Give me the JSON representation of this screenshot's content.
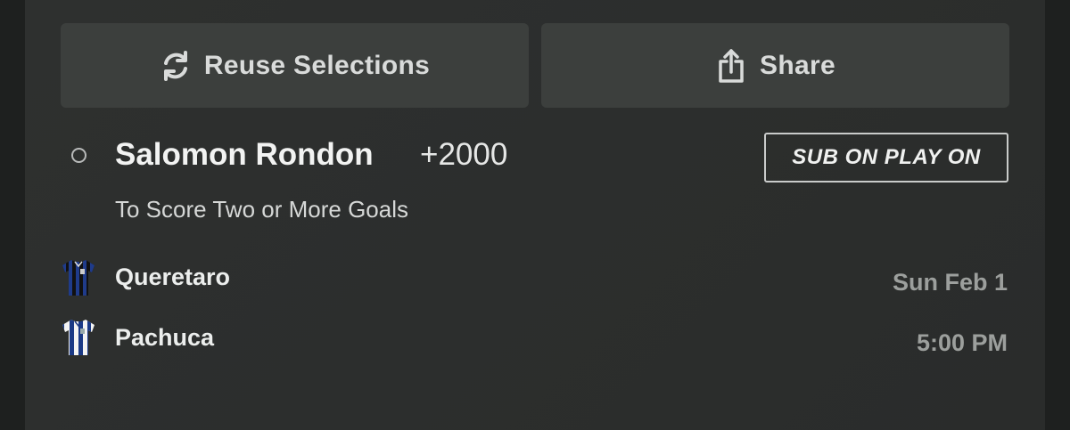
{
  "actions": {
    "reuse_label": "Reuse Selections",
    "share_label": "Share",
    "reuse_icon": "refresh-icon",
    "share_icon": "share-icon"
  },
  "selection": {
    "player": "Salomon Rondon",
    "odds": "+2000",
    "badge": "SUB ON PLAY ON",
    "market": "To Score Two or More Goals"
  },
  "match": {
    "home_team": "Queretaro",
    "away_team": "Pachuca",
    "date": "Sun Feb 1",
    "time": "5:00 PM",
    "home_jersey_icon": "queretaro-jersey-icon",
    "away_jersey_icon": "pachuca-jersey-icon"
  },
  "colors": {
    "card_bg": "#2d2f2e",
    "button_bg": "#3c3f3d",
    "text_primary": "#f2f3f2",
    "text_muted": "#9c9f9d"
  }
}
